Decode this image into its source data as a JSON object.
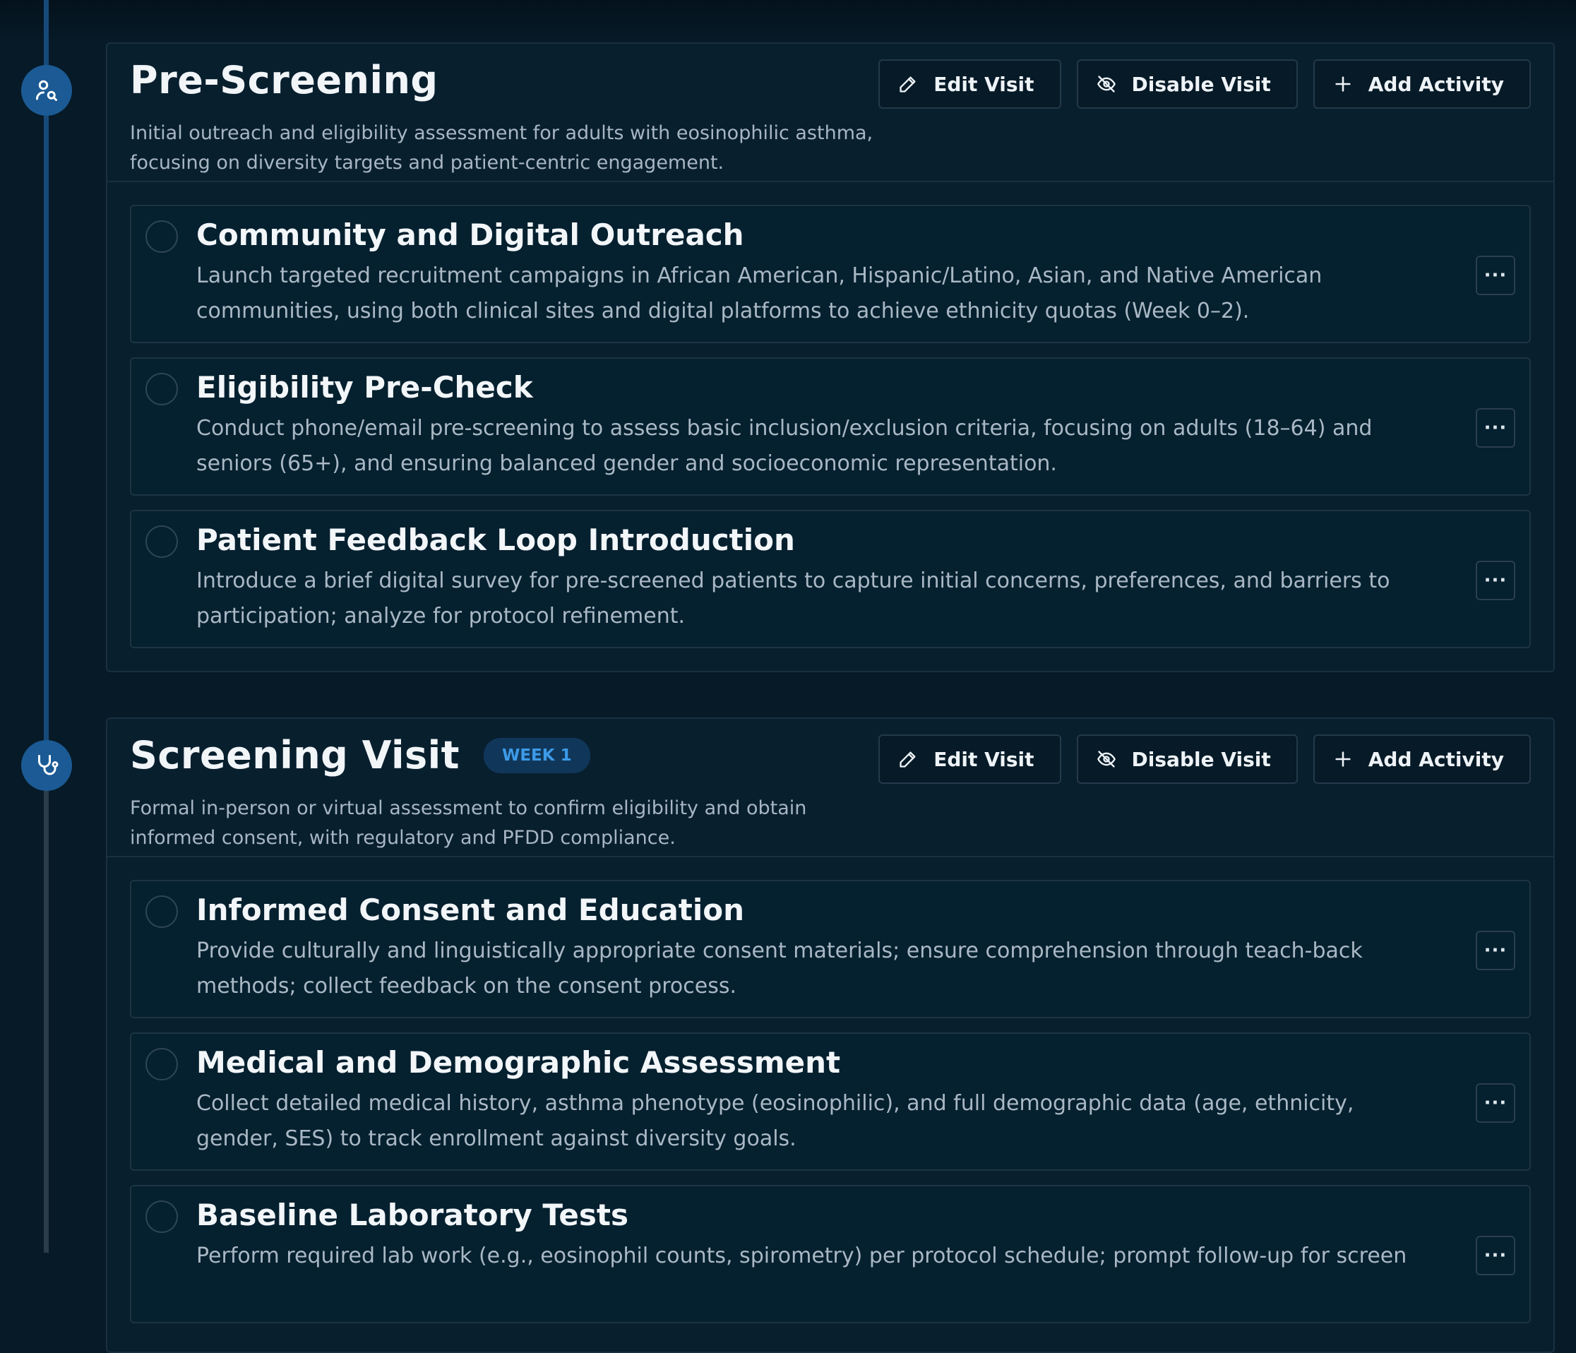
{
  "visits": [
    {
      "title": "Pre-Screening",
      "badge": "",
      "description": "Initial outreach and eligibility assessment for adults with eosinophilic asthma, focusing on diversity targets and patient-centric engagement.",
      "icon": "user-search-icon",
      "actions": {
        "edit": "Edit Visit",
        "disable": "Disable Visit",
        "add": "Add Activity"
      },
      "activities": [
        {
          "title": "Community and Digital Outreach",
          "description": "Launch targeted recruitment campaigns in African American, Hispanic/Latino, Asian, and Native American communities, using both clinical sites and digital platforms to achieve ethnicity quotas (Week 0–2)."
        },
        {
          "title": "Eligibility Pre-Check",
          "description": "Conduct phone/email pre-screening to assess basic inclusion/exclusion criteria, focusing on adults (18–64) and seniors (65+), and ensuring balanced gender and socioeconomic representation."
        },
        {
          "title": "Patient Feedback Loop Introduction",
          "description": "Introduce a brief digital survey for pre-screened patients to capture initial concerns, preferences, and barriers to participation; analyze for protocol refinement."
        }
      ]
    },
    {
      "title": "Screening Visit",
      "badge": "WEEK 1",
      "description": "Formal in-person or virtual assessment to confirm eligibility and obtain informed consent, with regulatory and PFDD compliance.",
      "icon": "stethoscope-icon",
      "actions": {
        "edit": "Edit Visit",
        "disable": "Disable Visit",
        "add": "Add Activity"
      },
      "activities": [
        {
          "title": "Informed Consent and Education",
          "description": "Provide culturally and linguistically appropriate consent materials; ensure comprehension through teach-back methods; collect feedback on the consent process."
        },
        {
          "title": "Medical and Demographic Assessment",
          "description": "Collect detailed medical history, asthma phenotype (eosinophilic), and full demographic data (age, ethnicity, gender, SES) to track enrollment against diversity goals."
        },
        {
          "title": "Baseline Laboratory Tests",
          "description": "Perform required lab work (e.g., eosinophil counts, spirometry) per protocol schedule; prompt follow-up for screen"
        }
      ]
    }
  ],
  "more_label": "···",
  "colors": {
    "accent": "#1b5a94",
    "badge_text": "#3d9ae8",
    "background": "#061a27"
  }
}
